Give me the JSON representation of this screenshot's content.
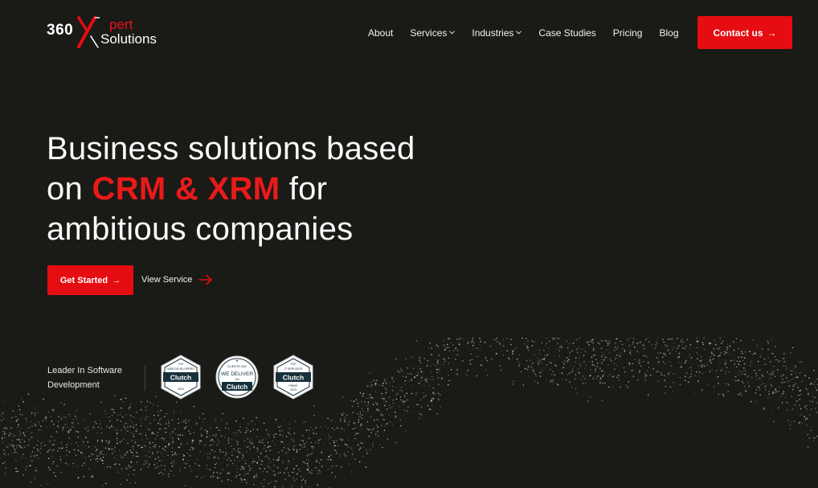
{
  "brand": {
    "logo_number": "360",
    "logo_pert": "pert",
    "logo_solutions": "Solutions"
  },
  "nav": {
    "items": [
      {
        "label": "About",
        "has_dropdown": false
      },
      {
        "label": "Services",
        "has_dropdown": true
      },
      {
        "label": "Industries",
        "has_dropdown": true
      },
      {
        "label": "Case Studies",
        "has_dropdown": false
      },
      {
        "label": "Pricing",
        "has_dropdown": false
      },
      {
        "label": "Blog",
        "has_dropdown": false
      }
    ],
    "dropdown_icon": "chevron-down-icon",
    "contact_label": "Contact us",
    "contact_arrow": "→"
  },
  "hero": {
    "line1": "Business solutions based",
    "line2_prefix": "on ",
    "line2_accent": "CRM & XRM",
    "line2_suffix": " for",
    "line3": "ambitious companies"
  },
  "cta": {
    "primary_label": "Get Started",
    "primary_arrow": "→",
    "secondary_label": "View Service"
  },
  "badges": {
    "leader_text": "Leader In Software Development",
    "items": [
      {
        "top": "TOP",
        "sub": "WEB DEVELOPERS",
        "brand": "Clutch",
        "year": "2023"
      },
      {
        "top": "CLIENTS SAY",
        "sub": "WE DELIVER",
        "on": "ON",
        "brand": "Clutch"
      },
      {
        "top": "TOP",
        "sub": "IT SERVICES",
        "brand": "Clutch",
        "extra": "FIRMS",
        "year": "2023"
      }
    ]
  },
  "colors": {
    "background": "#1a1a17",
    "accent": "#e50d12",
    "text": "#ffffff",
    "badge_teal": "#17313b"
  }
}
